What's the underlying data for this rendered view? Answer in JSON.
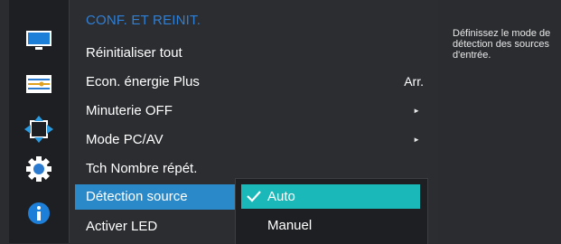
{
  "sidebar": {
    "icons": [
      "monitor-icon",
      "picture-settings-icon",
      "resize-arrows-icon",
      "gear-icon",
      "info-icon"
    ]
  },
  "menu": {
    "title": "CONF. ET REINIT.",
    "items": [
      {
        "label": "Réinitialiser tout",
        "value": "",
        "arrow": ""
      },
      {
        "label": "Econ. énergie Plus",
        "value": "Arr.",
        "arrow": ""
      },
      {
        "label": "Minuterie OFF",
        "value": "",
        "arrow": "►"
      },
      {
        "label": "Mode PC/AV",
        "value": "",
        "arrow": "►"
      },
      {
        "label": "Tch Nombre répét.",
        "value": "",
        "arrow": ""
      },
      {
        "label": "Détection source",
        "value": "",
        "arrow": ""
      },
      {
        "label": "Activer LED",
        "value": "",
        "arrow": ""
      }
    ],
    "selected_index": 5
  },
  "submenu": {
    "options": [
      {
        "label": "Auto",
        "selected": true
      },
      {
        "label": "Manuel",
        "selected": false
      }
    ]
  },
  "info": {
    "text": "Définissez le mode de détection des sources d'entrée."
  },
  "colors": {
    "title": "#2f7fd6",
    "selected_row": "#2a89c8",
    "active_option": "#1ab8b8"
  }
}
